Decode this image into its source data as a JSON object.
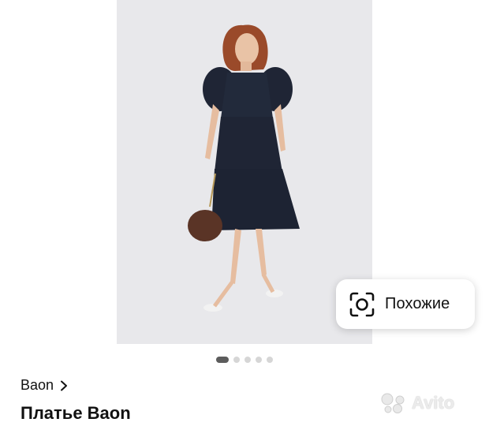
{
  "similar_button": {
    "label": "Похожие",
    "icon": "camera-search-icon"
  },
  "carousel": {
    "total": 5,
    "active_index": 0
  },
  "brand": {
    "label": "Baon",
    "icon": "chevron-right-icon"
  },
  "product": {
    "title": "Платье Baon"
  },
  "watermark": {
    "text": "Avito"
  },
  "colors": {
    "background": "#ffffff",
    "photo_bg": "#e9e9ec",
    "dress": "#1f2535",
    "dot_active": "#5c5c5c",
    "dot_inactive": "#d6d6d6"
  }
}
